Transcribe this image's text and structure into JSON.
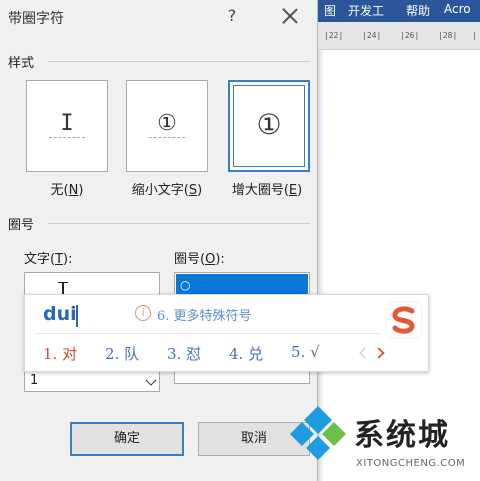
{
  "background_app": {
    "ribbon_tabs": [
      "图",
      "开发工",
      "帮助",
      "Acro"
    ],
    "ruler_ticks": [
      "|22|",
      "|24|",
      "|26|",
      "|28|",
      "|"
    ]
  },
  "dialog": {
    "title": "带圈字符",
    "help_label": "?",
    "style_group": {
      "label": "样式",
      "options": [
        {
          "glyph": "I",
          "label": "无(",
          "key": "N",
          "suffix": ")"
        },
        {
          "glyph": "①",
          "label": "缩小文字(",
          "key": "S",
          "suffix": ")"
        },
        {
          "glyph": "①",
          "label": "增大圈号(",
          "key": "E",
          "suffix": ")"
        }
      ],
      "selected_index": 2
    },
    "circle_group": {
      "label": "圈号",
      "text_field": {
        "label": "文字(",
        "key": "T",
        "suffix": "):",
        "value": ""
      },
      "circle_field": {
        "label": "圈号(",
        "key": "O",
        "suffix": "):",
        "selected": "○"
      },
      "combo_value": "1"
    },
    "ok_label": "确定",
    "cancel_label": "取消"
  },
  "ime": {
    "input": "dui",
    "hint_icon": "i",
    "hint": "6. 更多特殊符号",
    "candidates": [
      "1. 对",
      "2. 队",
      "3. 怼",
      "4. 兑",
      "5. √"
    ]
  },
  "watermark": {
    "name": "系统城",
    "url": "XITONGCHENG.COM"
  },
  "colors": {
    "accent": "#3c7fc1",
    "selection": "#0a78d7",
    "ime_first": "#d7473a",
    "ime_text": "#4a6fae"
  }
}
